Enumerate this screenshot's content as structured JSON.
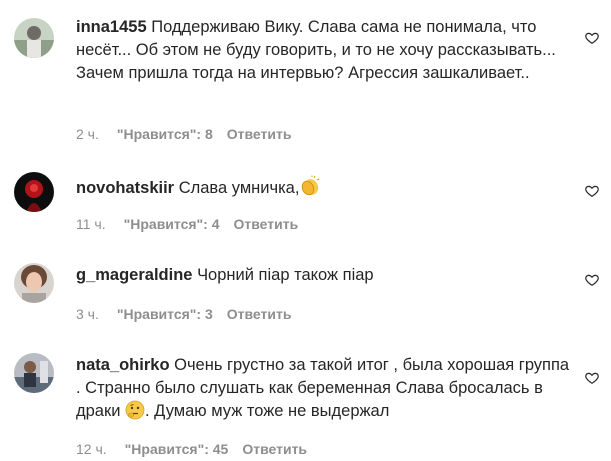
{
  "comments": [
    {
      "username": "inna1455",
      "text": "Поддерживаю Вику. Слава сама не понимала, что несёт... Об этом не буду говорить, и то не хочу рассказывать... Зачем пришла тогда на интервью? Агрессия зашкаливает..",
      "time": "2 ч.",
      "likes": "\"Нравится\": 8",
      "reply": "Ответить",
      "avatar_icon": "avatar-photo"
    },
    {
      "username": "novohatskiir",
      "text": "Слава умничка,",
      "emoji": "clapping-hands-icon",
      "time": "11 ч.",
      "likes": "\"Нравится\": 4",
      "reply": "Ответить",
      "avatar_icon": "avatar-photo"
    },
    {
      "username": "g_mageraldine",
      "text": "Чорний піар також піар",
      "time": "3 ч.",
      "likes": "\"Нравится\": 3",
      "reply": "Ответить",
      "avatar_icon": "avatar-photo"
    },
    {
      "username": "nata_ohirko",
      "text_before": "Очень грустно за такой итог , была хорошая группа . Странно было слушать как беременная Слава бросалась в драки",
      "emoji": "thinking-face-icon",
      "text_after": ". Думаю муж тоже не выдержал",
      "time": "12 ч.",
      "likes": "\"Нравится\": 45",
      "reply": "Ответить",
      "avatar_icon": "avatar-photo"
    }
  ],
  "colors": {
    "text": "#262626",
    "meta": "#8e8e8e",
    "heart_stroke": "#262626"
  },
  "icons": {
    "like": "heart-outline-icon"
  }
}
